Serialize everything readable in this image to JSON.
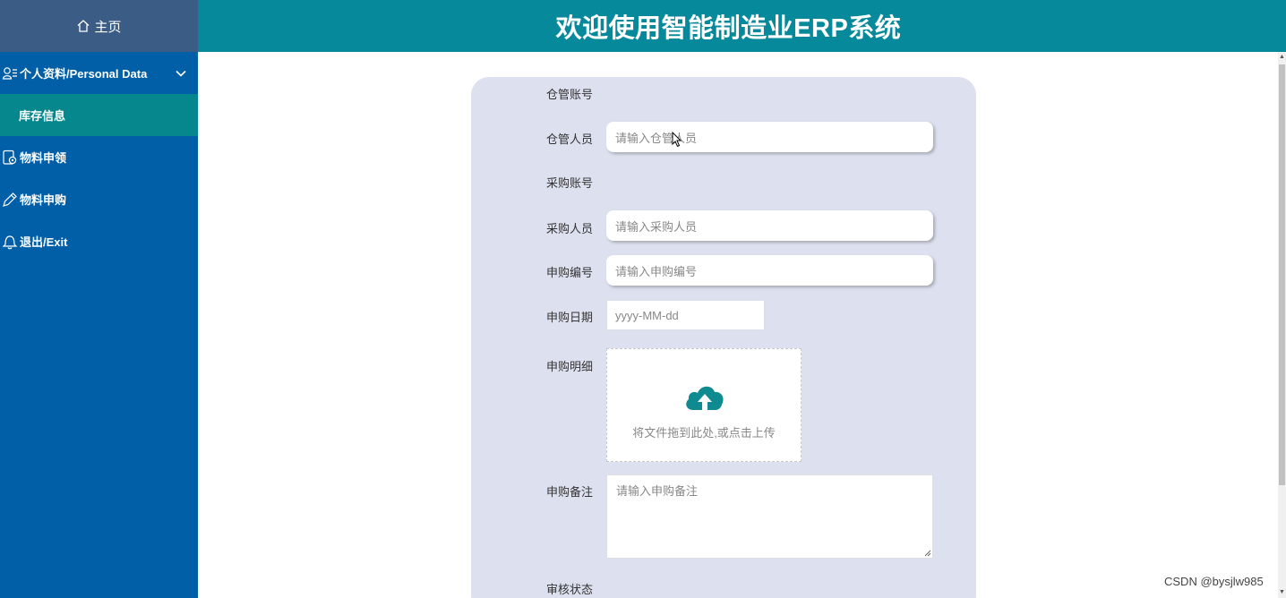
{
  "sidebar": {
    "home_label": "主页",
    "items": [
      {
        "label": "个人资料/Personal Data",
        "icon": "user-list-icon"
      },
      {
        "label": "库存信息",
        "icon": ""
      },
      {
        "label": "物料申领",
        "icon": "settings-doc-icon"
      },
      {
        "label": "物料申购",
        "icon": "edit-pen-icon"
      },
      {
        "label": "退出/Exit",
        "icon": "exit-bell-icon"
      }
    ]
  },
  "header": {
    "title": "欢迎使用智能制造业ERP系统"
  },
  "form": {
    "warehouse_account_label": "仓管账号",
    "warehouse_staff_label": "仓管人员",
    "warehouse_staff_placeholder": "请输入仓管人员",
    "purchase_account_label": "采购账号",
    "purchaser_label": "采购人员",
    "purchaser_placeholder": "请输入采购人员",
    "request_no_label": "申购编号",
    "request_no_placeholder": "请输入申购编号",
    "request_date_label": "申购日期",
    "request_date_placeholder": "yyyy-MM-dd",
    "detail_label": "申购明细",
    "upload_text": "将文件拖到此处,或点击上传",
    "remark_label": "申购备注",
    "remark_placeholder": "请输入申购备注",
    "review_status_label": "审核状态"
  },
  "watermark": "CSDN @bysjlw985",
  "colors": {
    "sidebar_bg": "#005fa6",
    "sidebar_home_bg": "#3a5c85",
    "sidebar_active_bg": "#06878e",
    "header_bg": "#068a9b",
    "form_panel_bg": "#dde1ef",
    "upload_icon": "#0f8a90"
  }
}
